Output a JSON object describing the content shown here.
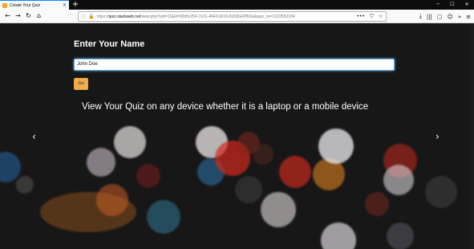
{
  "browser": {
    "tab_title": "Create Your Quiz",
    "tab_close": "×",
    "new_tab": "+",
    "window": {
      "minimize": "─",
      "maximize": "☐",
      "close": "✕"
    },
    "nav": {
      "back": "←",
      "forward": "→",
      "reload": "↻",
      "home": "⌂"
    },
    "url": {
      "info": "ⓘ",
      "lock": "🔒",
      "scheme": "https://",
      "host": "quiz.stackweb.net",
      "rest": "/view.php?uid=11&id=92d0c254-7e31-4642-b019-f0d18a42f63e&quiz_no=1122552184",
      "actions": [
        "•••",
        "⛉",
        "☆"
      ]
    },
    "toolbar": [
      "⤓",
      "|||",
      "▢",
      "☺",
      "»",
      "≡"
    ]
  },
  "page": {
    "heading": "Enter Your Name",
    "name_value": "John Doe",
    "go_label": "Go",
    "tagline": "View Your Quiz on any device whether it is a laptop or a mobile device",
    "prev_arrow": "‹",
    "next_arrow": "›"
  },
  "colors": {
    "accent": "#f0ad4e",
    "input_focus": "#66afe9",
    "background": "#171717"
  }
}
